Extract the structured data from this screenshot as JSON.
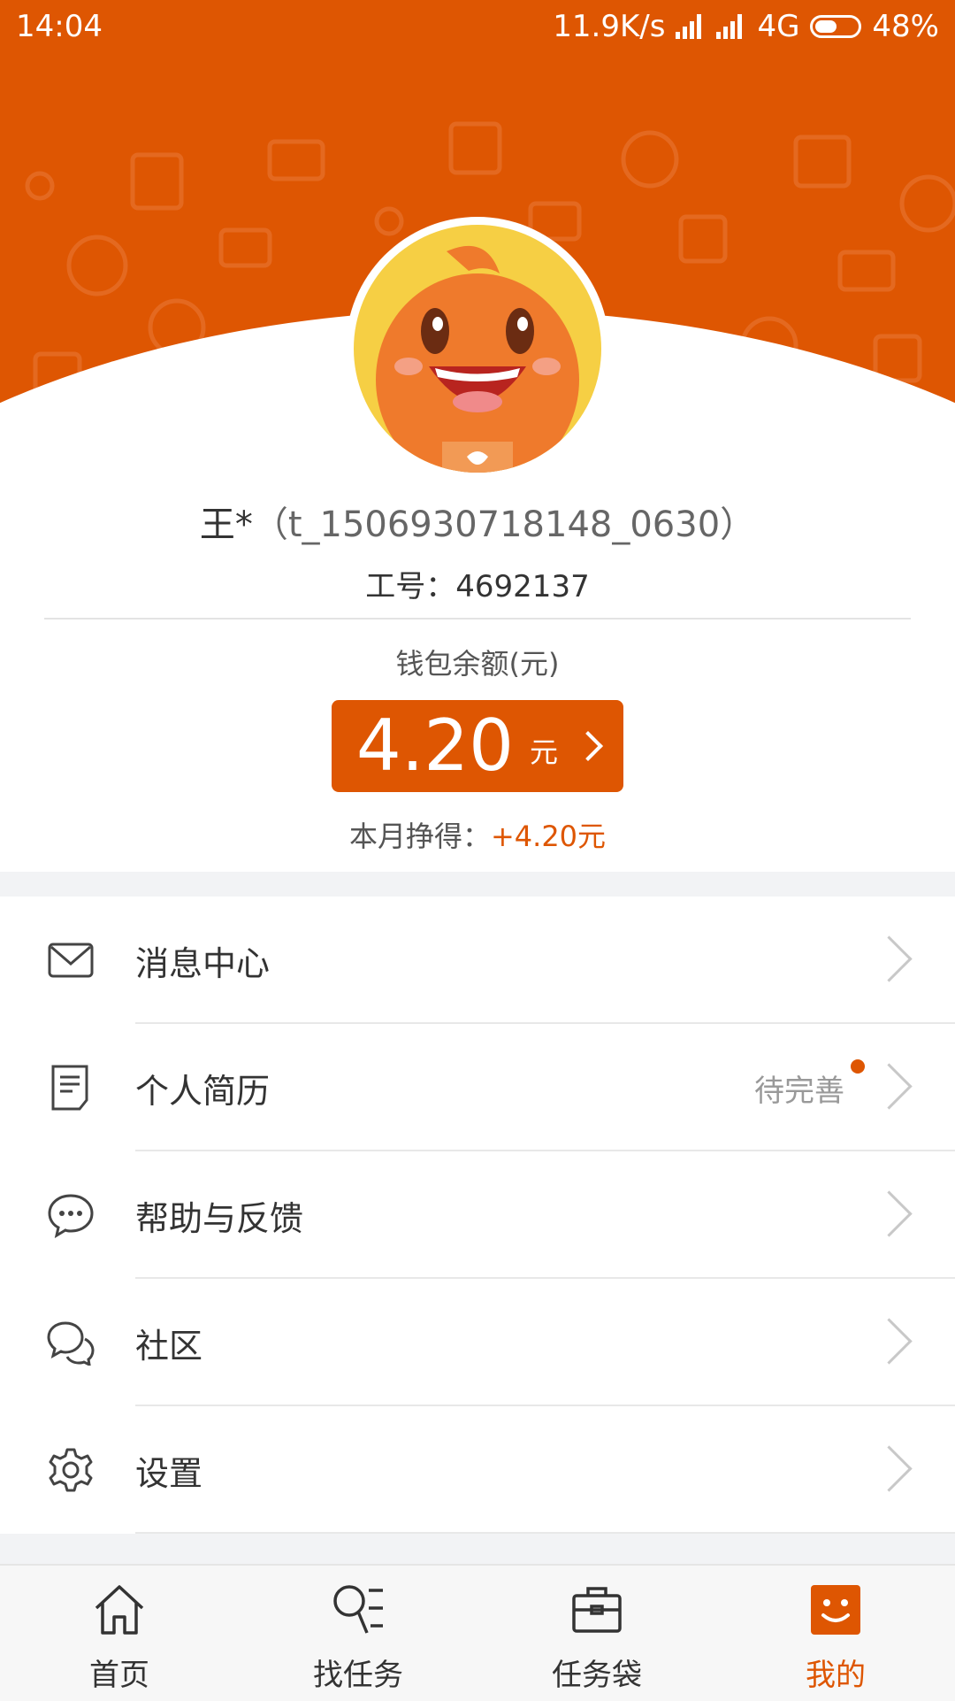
{
  "status_bar": {
    "time": "14:04",
    "speed": "11.9K/s",
    "network": "4G",
    "battery": "48%"
  },
  "profile": {
    "name": "王*",
    "account_id": "（t_1506930718148_0630）",
    "employee_no_label": "工号：",
    "employee_no": "4692137",
    "wallet_label": "钱包余额(元)",
    "balance": "4.20",
    "balance_unit": "元",
    "monthly_label": "本月挣得：",
    "monthly_value": "+4.20元"
  },
  "menu": [
    {
      "label": "消息中心",
      "icon": "mail-icon"
    },
    {
      "label": "个人简历",
      "icon": "document-icon",
      "hint": "待完善"
    },
    {
      "label": "帮助与反馈",
      "icon": "chat-bubble-icon"
    },
    {
      "label": "社区",
      "icon": "community-icon"
    },
    {
      "label": "设置",
      "icon": "gear-icon"
    }
  ],
  "tabs": [
    {
      "label": "首页",
      "icon": "home-icon"
    },
    {
      "label": "找任务",
      "icon": "search-list-icon"
    },
    {
      "label": "任务袋",
      "icon": "briefcase-icon"
    },
    {
      "label": "我的",
      "icon": "smiley-icon",
      "active": true
    }
  ],
  "colors": {
    "brand": "#de5602",
    "avatar_bg": "#f6cf44"
  }
}
